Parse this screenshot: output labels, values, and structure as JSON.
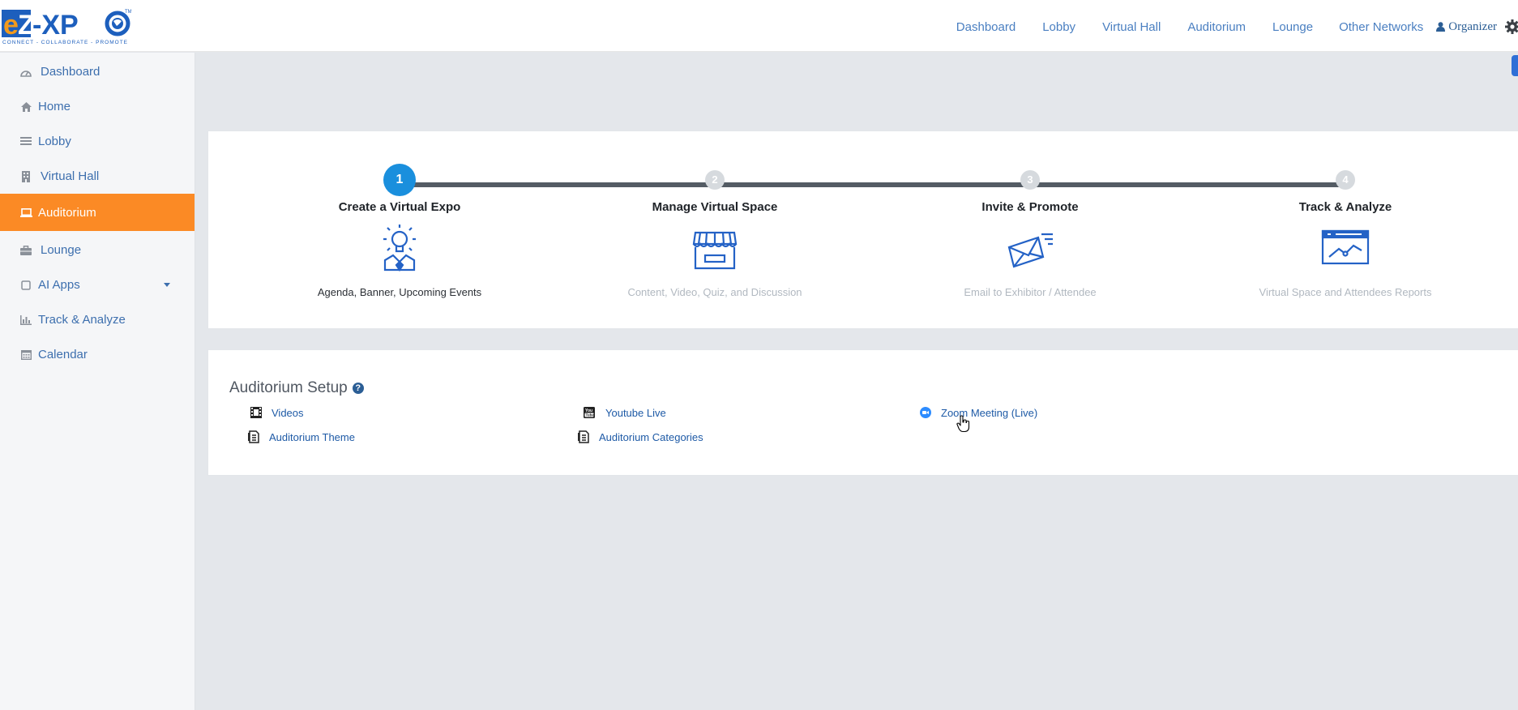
{
  "brand": {
    "logo_text": "eZ-XPO",
    "tagline": "CONNECT - COLLABORATE - PROMOTE",
    "trademark": "TM"
  },
  "topnav": {
    "items": [
      "Dashboard",
      "Lobby",
      "Virtual Hall",
      "Auditorium",
      "Lounge",
      "Other Networks"
    ],
    "user_label": "Organizer",
    "user_icon": "user-icon",
    "settings_icon": "gear-icon"
  },
  "sidebar": {
    "active_index": 4,
    "items": [
      {
        "label": "Dashboard",
        "icon": "dashboard-icon"
      },
      {
        "label": "Home",
        "icon": "home-icon"
      },
      {
        "label": "Lobby",
        "icon": "lobby-icon"
      },
      {
        "label": "Virtual Hall",
        "icon": "building-icon"
      },
      {
        "label": "Auditorium",
        "icon": "laptop-icon"
      },
      {
        "label": "Lounge",
        "icon": "briefcase-icon"
      },
      {
        "label": "AI Apps",
        "icon": "square-icon",
        "has_dropdown": true
      },
      {
        "label": "Track & Analyze",
        "icon": "bar-chart-icon"
      },
      {
        "label": "Calendar",
        "icon": "calendar-icon"
      }
    ]
  },
  "steps": {
    "active_step": 1,
    "items": [
      {
        "number": "1",
        "title": "Create a Virtual Expo",
        "description": "Agenda, Banner, Upcoming Events",
        "icon": "lightbulb-presenter-icon"
      },
      {
        "number": "2",
        "title": "Manage Virtual Space",
        "description": "Content, Video, Quiz, and Discussion",
        "icon": "storefront-icon"
      },
      {
        "number": "3",
        "title": "Invite & Promote",
        "description": "Email to Exhibitor / Attendee",
        "icon": "envelope-send-icon"
      },
      {
        "number": "4",
        "title": "Track & Analyze",
        "description": "Virtual Space and Attendees Reports",
        "icon": "analytics-window-icon"
      }
    ]
  },
  "setup": {
    "title": "Auditorium Setup",
    "help_icon": "question-circle-icon",
    "links": [
      {
        "label": "Videos",
        "icon": "film-icon"
      },
      {
        "label": "Youtube Live",
        "icon": "youtube-icon"
      },
      {
        "label": "Zoom Meeting (Live)",
        "icon": "zoom-icon"
      },
      {
        "label": "Auditorium Theme",
        "icon": "document-icon"
      },
      {
        "label": "Auditorium Categories",
        "icon": "document-icon"
      }
    ]
  },
  "colors": {
    "accent": "#fb8a25",
    "link": "#4a7fc1",
    "step_active": "#1a8fdd",
    "track": "#545c64"
  }
}
